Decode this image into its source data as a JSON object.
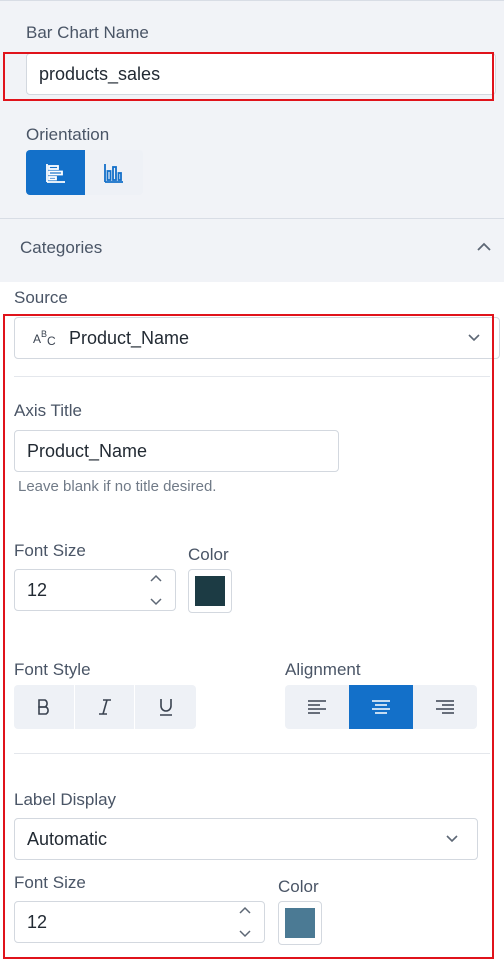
{
  "chart_name": {
    "label": "Bar Chart Name",
    "value": "products_sales"
  },
  "orientation": {
    "label": "Orientation",
    "options": [
      "horizontal-bars-icon",
      "vertical-bars-icon"
    ],
    "selected": "horizontal-bars-icon"
  },
  "categories": {
    "title": "Categories",
    "expanded": true
  },
  "source": {
    "label": "Source",
    "type_icon": "text-type-icon",
    "value": "Product_Name"
  },
  "axis_title": {
    "label": "Axis Title",
    "value": "Product_Name",
    "hint": "Leave blank if no title desired."
  },
  "axis_font": {
    "size_label": "Font Size",
    "size_value": "12",
    "color_label": "Color",
    "color": "#1c3b44"
  },
  "font_style": {
    "label": "Font Style",
    "options": [
      "bold-icon",
      "italic-icon",
      "underline-icon"
    ]
  },
  "alignment": {
    "label": "Alignment",
    "options": [
      "align-left-icon",
      "align-center-icon",
      "align-right-icon"
    ],
    "selected": "align-center-icon"
  },
  "label_display": {
    "label": "Label Display",
    "value": "Automatic"
  },
  "label_font": {
    "size_label": "Font Size",
    "size_value": "12",
    "color_label": "Color",
    "color": "#4b7a94"
  },
  "colors": {
    "accent": "#1370c9",
    "highlight": "#e0131b"
  }
}
